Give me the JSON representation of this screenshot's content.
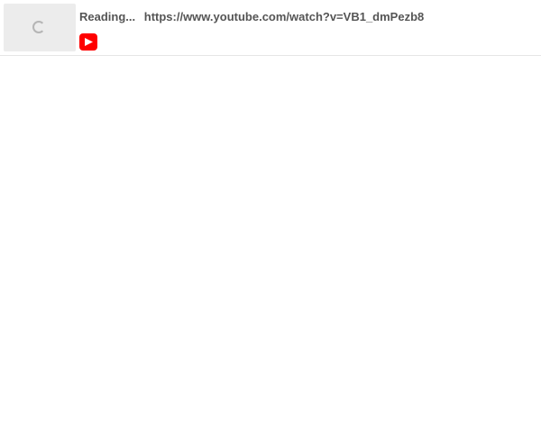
{
  "link_preview": {
    "status": "Reading...",
    "url": "https://www.youtube.com/watch?v=VB1_dmPezb8",
    "thumbnail_state": "loading",
    "source_icon": "youtube-icon",
    "brand_color": "#ff0000"
  }
}
